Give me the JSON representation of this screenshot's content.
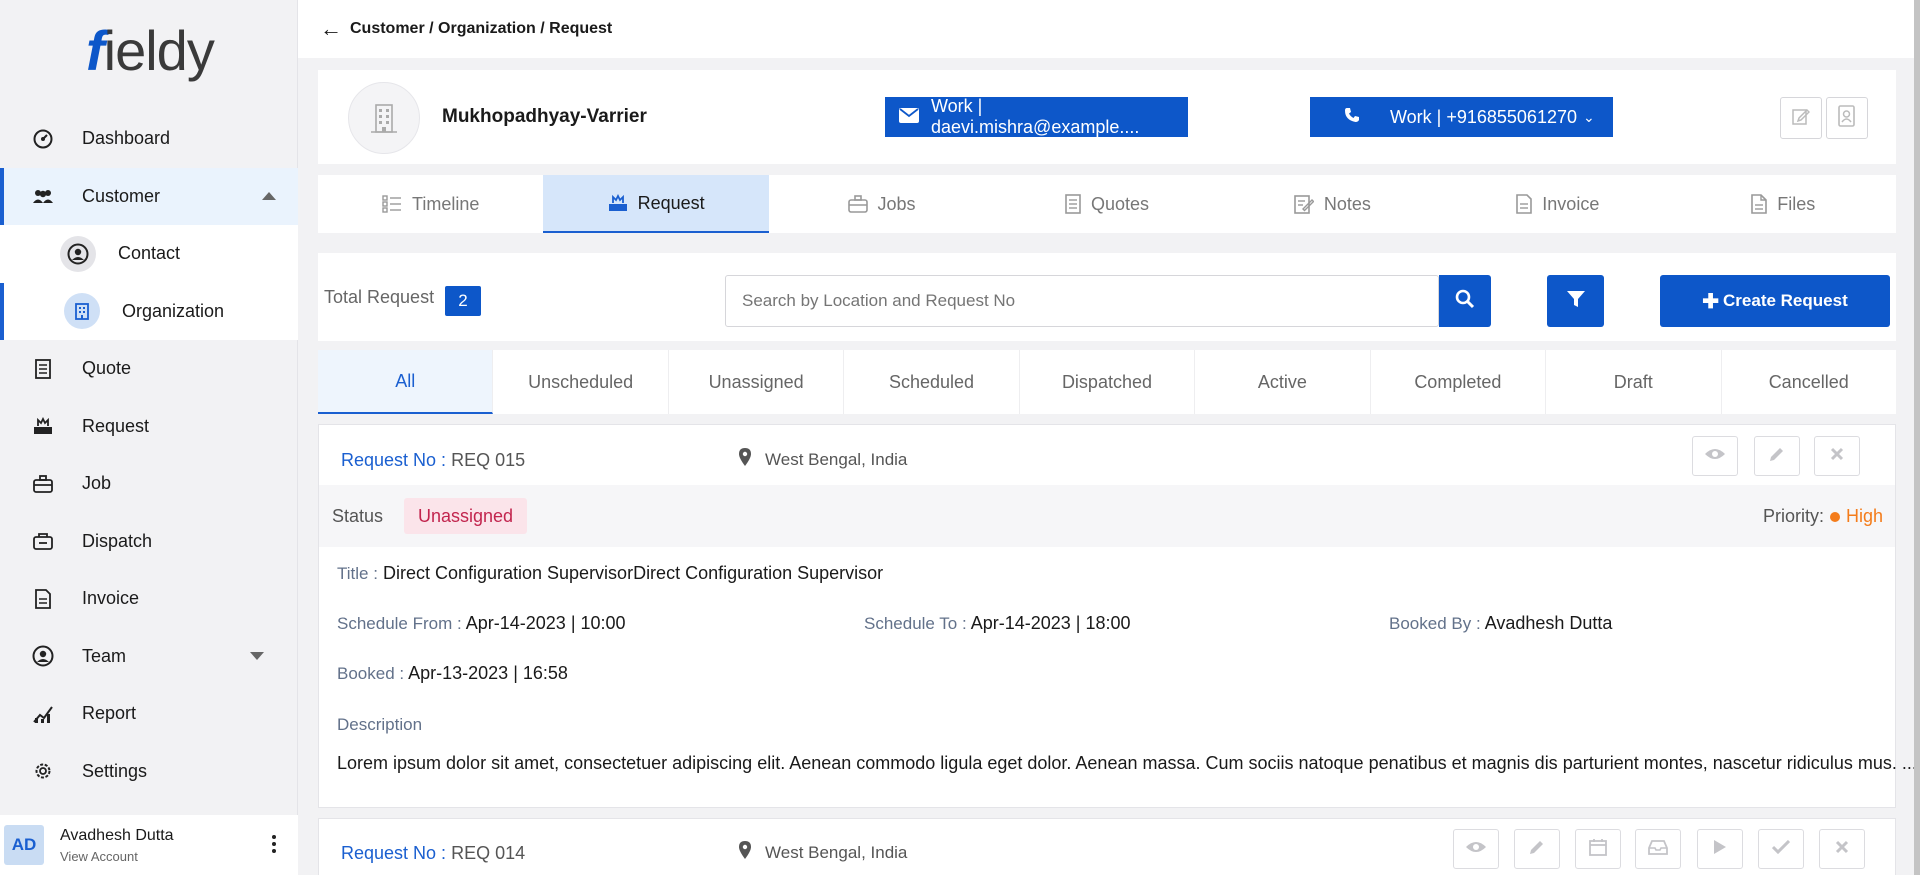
{
  "app": {
    "logo_first": "f",
    "logo_rest": "ieldy"
  },
  "breadcrumb": "Customer / Organization / Request",
  "sidebar": {
    "items": [
      {
        "label": "Dashboard",
        "icon": "dashboard-icon"
      },
      {
        "label": "Customer",
        "icon": "customers-icon"
      },
      {
        "label": "Contact",
        "icon": "contact-icon"
      },
      {
        "label": "Organization",
        "icon": "organization-icon"
      },
      {
        "label": "Quote",
        "icon": "quote-icon"
      },
      {
        "label": "Request",
        "icon": "request-icon"
      },
      {
        "label": "Job",
        "icon": "job-icon"
      },
      {
        "label": "Dispatch",
        "icon": "dispatch-icon"
      },
      {
        "label": "Invoice",
        "icon": "invoice-icon"
      },
      {
        "label": "Team",
        "icon": "team-icon"
      },
      {
        "label": "Report",
        "icon": "report-icon"
      },
      {
        "label": "Settings",
        "icon": "settings-icon"
      }
    ]
  },
  "account": {
    "initials": "AD",
    "name": "Avadhesh Dutta",
    "link": "View Account"
  },
  "org": {
    "name": "Mukhopadhyay-Varrier",
    "email_btn": "Work | daevi.mishra@example....",
    "phone_btn": "Work | +916855061270"
  },
  "tabs": [
    "Timeline",
    "Request",
    "Jobs",
    "Quotes",
    "Notes",
    "Invoice",
    "Files"
  ],
  "toolbar": {
    "total_label": "Total Request",
    "total_count": "2",
    "search_placeholder": "Search by Location and Request No",
    "create_label": "Create Request"
  },
  "status_tabs": [
    "All",
    "Unscheduled",
    "Unassigned",
    "Scheduled",
    "Dispatched",
    "Active",
    "Completed",
    "Draft",
    "Cancelled"
  ],
  "requests": [
    {
      "no_label": "Request No :",
      "no": "REQ 015",
      "location": "West Bengal, India",
      "status_label": "Status",
      "status": "Unassigned",
      "priority_label": "Priority:",
      "priority": "High",
      "title_label": "Title :",
      "title": "Direct Configuration SupervisorDirect Configuration Supervisor",
      "schedule_from_label": "Schedule From :",
      "schedule_from": "Apr-14-2023 | 10:00",
      "schedule_to_label": "Schedule To :",
      "schedule_to": "Apr-14-2023 | 18:00",
      "booked_by_label": "Booked By :",
      "booked_by": "Avadhesh Dutta",
      "booked_label": "Booked :",
      "booked": "Apr-13-2023 | 16:58",
      "description_label": "Description",
      "description": "Lorem ipsum dolor sit amet, consectetuer adipiscing elit. Aenean commodo ligula eget dolor. Aenean massa. Cum sociis natoque penatibus et magnis dis parturient montes, nascetur ridiculus mus. ..."
    },
    {
      "no_label": "Request No :",
      "no": "REQ 014",
      "location": "West Bengal, India"
    }
  ],
  "colors": {
    "primary": "#0d57c9",
    "status_unassigned": "#c2254e",
    "priority_high": "#f47c1b"
  }
}
